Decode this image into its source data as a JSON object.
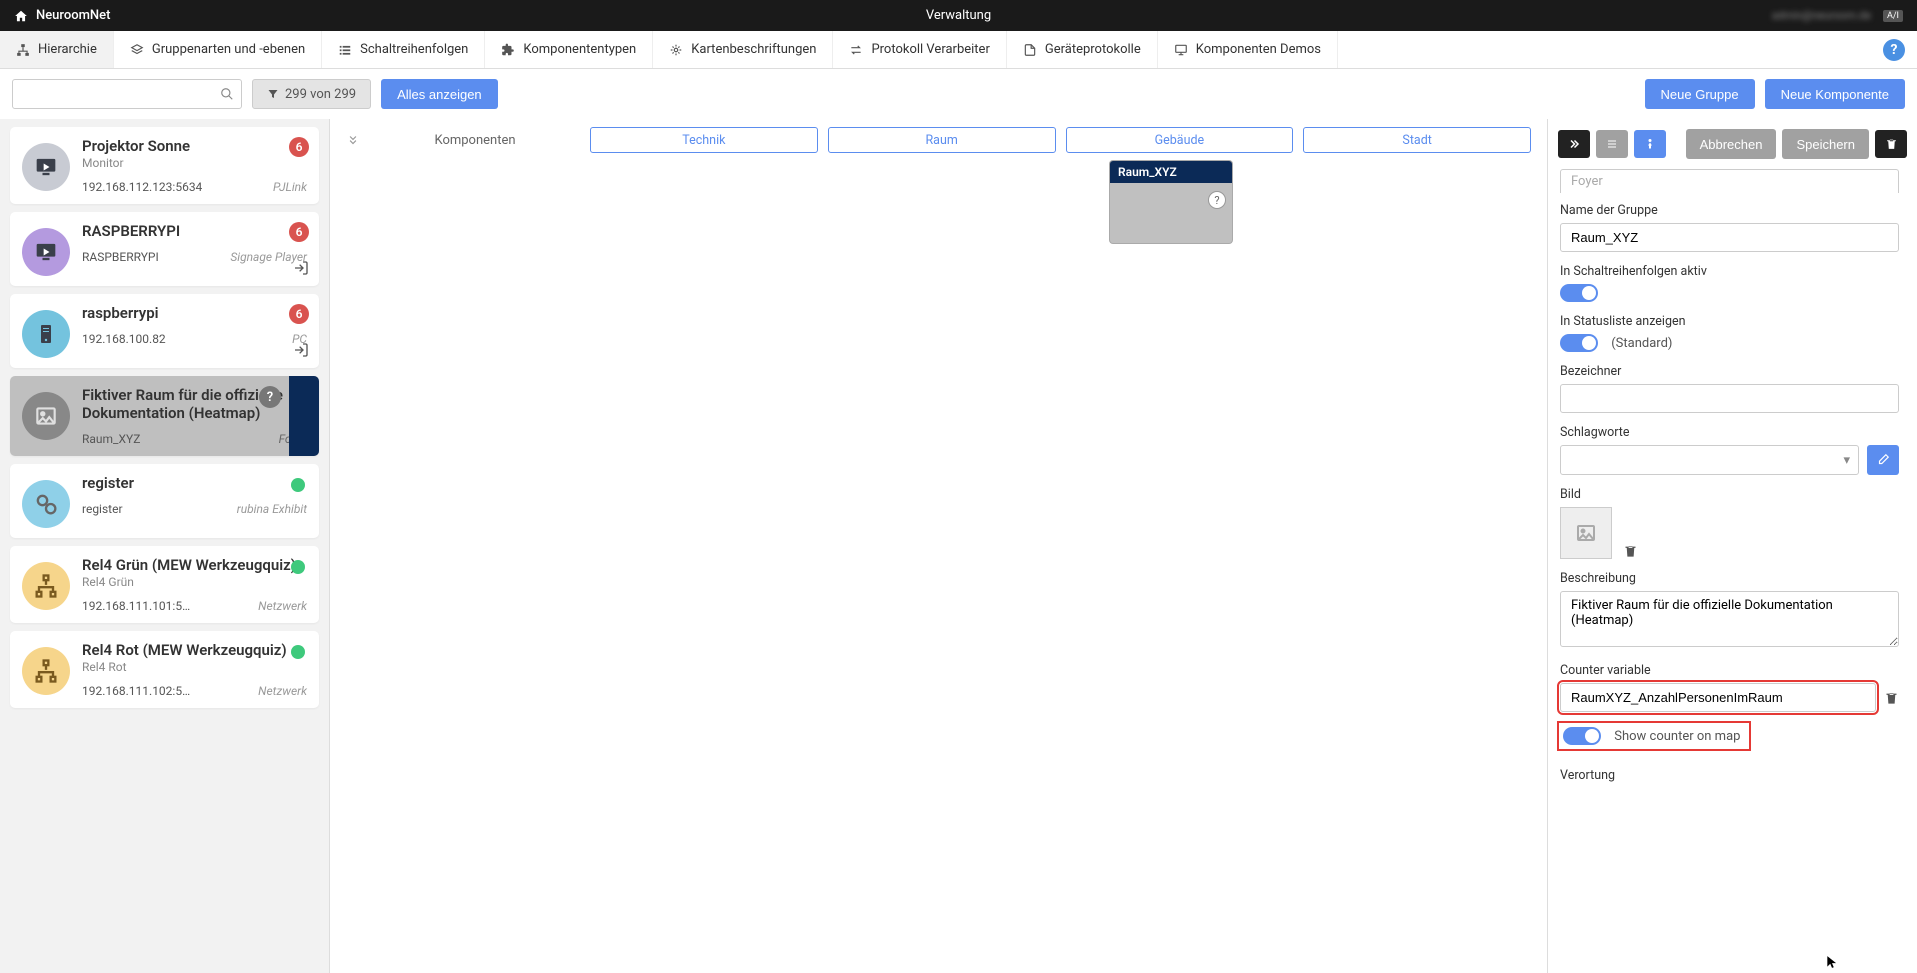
{
  "topbar": {
    "brand": "NeuroomNet",
    "center": "Verwaltung",
    "user_blur": "admin@neuroom.de",
    "lang": "A/I"
  },
  "nav": {
    "tabs": [
      {
        "label": "Hierarchie",
        "icon": "sitemap"
      },
      {
        "label": "Gruppenarten und -ebenen",
        "icon": "layers"
      },
      {
        "label": "Schaltreihenfolgen",
        "icon": "list"
      },
      {
        "label": "Komponententypen",
        "icon": "puzzle"
      },
      {
        "label": "Kartenbeschriftungen",
        "icon": "tags"
      },
      {
        "label": "Protokoll Verarbeiter",
        "icon": "exchange"
      },
      {
        "label": "Geräteprotokolle",
        "icon": "file"
      },
      {
        "label": "Komponenten Demos",
        "icon": "desktop"
      }
    ]
  },
  "actionbar": {
    "search_placeholder": "",
    "filter_label": "299 von 299",
    "show_all": "Alles anzeigen",
    "new_group": "Neue Gruppe",
    "new_component": "Neue Komponente"
  },
  "sidebar": {
    "items": [
      {
        "title": "Projektor Sonne",
        "sub": "Monitor",
        "addr": "192.168.112.123:5634",
        "type": "PJLink",
        "badge": "6",
        "badgekind": "red",
        "thumb_color": "#c8cbd3",
        "thumb_icon": "play"
      },
      {
        "title": "RASPBERRYPI",
        "sub": "",
        "addr": "RASPBERRYPI",
        "type": "Signage Player",
        "badge": "6",
        "badgekind": "red",
        "thumb_color": "#b49adf",
        "thumb_icon": "play",
        "login": true
      },
      {
        "title": "raspberrypi",
        "sub": "",
        "addr": "192.168.100.82",
        "type": "PC",
        "badge": "6",
        "badgekind": "red",
        "thumb_color": "#74c3de",
        "thumb_icon": "server",
        "login": true
      },
      {
        "title": "Fiktiver Raum für die offizielle Dokumentation (Heatmap)",
        "sub": "",
        "addr": "Raum_XYZ",
        "type": "Foyer",
        "badge": "?",
        "badgekind": "help",
        "selected": true,
        "thumb_color": "#888",
        "thumb_icon": "image"
      },
      {
        "title": "register",
        "sub": "",
        "addr": "register",
        "type": "rubina Exhibit",
        "badge": "",
        "badgekind": "green",
        "thumb_color": "#8fd0e8",
        "thumb_icon": "gears"
      },
      {
        "title": "Rel4 Grün (MEW Werkzeugquiz)",
        "sub": "Rel4 Grün",
        "addr": "192.168.111.101:5…",
        "type": "Netzwerk",
        "badge": "",
        "badgekind": "green",
        "thumb_color": "#f6d58b",
        "thumb_icon": "nodes"
      },
      {
        "title": "Rel4 Rot (MEW Werkzeugquiz)",
        "sub": "Rel4 Rot",
        "addr": "192.168.111.102:5…",
        "type": "Netzwerk",
        "badge": "",
        "badgekind": "green",
        "thumb_color": "#f6d58b",
        "thumb_icon": "nodes"
      }
    ]
  },
  "canvas": {
    "columns_label": "Komponenten",
    "breadcrumbs": [
      "Technik",
      "Raum",
      "Gebäude",
      "Stadt"
    ],
    "room_card": {
      "title": "Raum_XYZ"
    }
  },
  "props": {
    "buttons": {
      "cancel": "Abbrechen",
      "save": "Speichern"
    },
    "foyer_partial": "Foyer",
    "group_name_label": "Name der Gruppe",
    "group_name_value": "Raum_XYZ",
    "switch_active_label": "In Schaltreihenfolgen aktiv",
    "statuslist_label": "In Statusliste anzeigen",
    "statuslist_hint": "(Standard)",
    "identifier_label": "Bezeichner",
    "identifier_value": "",
    "tags_label": "Schlagworte",
    "image_label": "Bild",
    "desc_label": "Beschreibung",
    "desc_value": "Fiktiver Raum für die offizielle Dokumentation (Heatmap)",
    "counter_label": "Counter variable",
    "counter_value": "RaumXYZ_AnzahlPersonenImRaum",
    "show_counter_label": "Show counter on map",
    "location_label": "Verortung"
  }
}
